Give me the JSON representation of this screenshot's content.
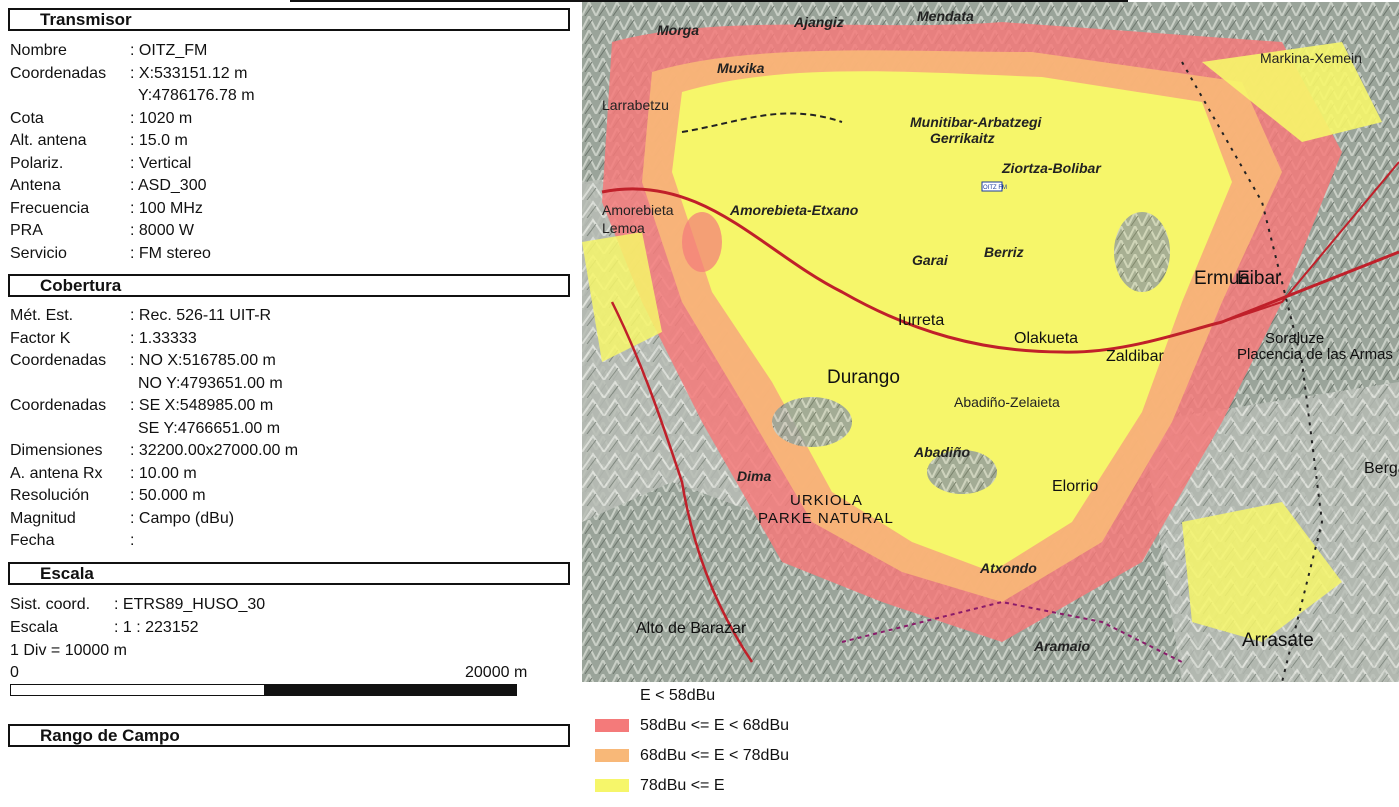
{
  "transmisor": {
    "title": "Transmisor",
    "rows": [
      {
        "label": "Nombre",
        "value": ": OITZ_FM"
      },
      {
        "label": "Coordenadas",
        "value": ": X:533151.12 m"
      },
      {
        "label": "",
        "value": "Y:4786176.78 m"
      },
      {
        "label": "Cota",
        "value": ": 1020 m"
      },
      {
        "label": "Alt. antena",
        "value": ": 15.0 m"
      },
      {
        "label": "Polariz.",
        "value": ": Vertical"
      },
      {
        "label": "Antena",
        "value": ": ASD_300"
      },
      {
        "label": "Frecuencia",
        "value": ": 100 MHz"
      },
      {
        "label": "PRA",
        "value": ": 8000 W"
      },
      {
        "label": "Servicio",
        "value": ": FM stereo"
      }
    ]
  },
  "cobertura": {
    "title": "Cobertura",
    "rows": [
      {
        "label": "Mét. Est.",
        "value": ": Rec. 526-11 UIT-R"
      },
      {
        "label": "Factor K",
        "value": ": 1.33333"
      },
      {
        "label": "Coordenadas",
        "value": ": NO X:516785.00 m"
      },
      {
        "label": "",
        "value": "NO Y:4793651.00 m"
      },
      {
        "label": "Coordenadas",
        "value": ": SE X:548985.00 m"
      },
      {
        "label": "",
        "value": "SE Y:4766651.00 m"
      },
      {
        "label": "Dimensiones",
        "value": ": 32200.00x27000.00 m"
      },
      {
        "label": "A. antena Rx",
        "value": ": 10.00 m"
      },
      {
        "label": "Resolución",
        "value": ": 50.000 m"
      },
      {
        "label": "Magnitud",
        "value": ": Campo (dBu)"
      },
      {
        "label": "Fecha",
        "value": ":"
      }
    ]
  },
  "escala": {
    "title": "Escala",
    "sist_label": "Sist. coord.",
    "sist_value": ": ETRS89_HUSO_30",
    "escala_label": "Escala",
    "escala_value": ": 1 : 223152",
    "div_text": "1 Div = 10000 m",
    "scale_start": "0",
    "scale_end": "20000 m"
  },
  "rango": {
    "title": "Rango de Campo"
  },
  "legend": [
    {
      "label": "E < 58dBu",
      "color": "#ffffff"
    },
    {
      "label": "58dBu <= E < 68dBu",
      "color": "#f47a7a"
    },
    {
      "label": "68dBu <= E < 78dBu",
      "color": "#f8b878"
    },
    {
      "label": "78dBu <= E",
      "color": "#f6f66a"
    }
  ],
  "map": {
    "transmitter_label": "OITZ FM",
    "labels": [
      "Morga",
      "Ajangiz",
      "Mendata",
      "Muxika",
      "Larrabetzu",
      "Markina-Xemein",
      "Munitibar-Arbatzegi",
      "Gerrikaitz",
      "Ziortza-Bolibar",
      "Amorebieta",
      "Lemoa",
      "Amorebieta-Etxano",
      "Garai",
      "Berriz",
      "Ermua",
      "Eibar",
      "Iurreta",
      "Olakueta",
      "Zaldibar",
      "Durango",
      "Abadiño-Zelaieta",
      "Soraluze",
      "Placencia de las Armas",
      "Dima",
      "Abadiño",
      "Atxondo",
      "Elorrio",
      "URKIOLA",
      "PARKE NATURAL",
      "Arrasate",
      "Alto de Barazar",
      "Aramaio",
      "Bergara"
    ]
  }
}
